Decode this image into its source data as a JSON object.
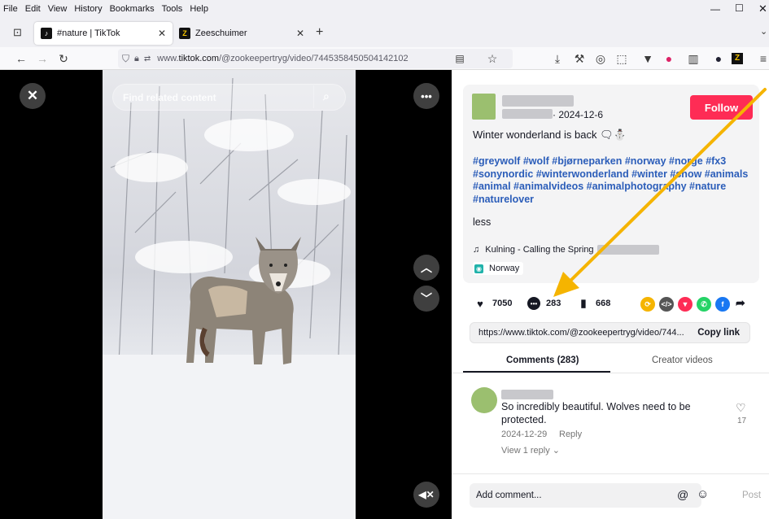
{
  "menu": [
    "File",
    "Edit",
    "View",
    "History",
    "Bookmarks",
    "Tools",
    "Help"
  ],
  "tabs": [
    {
      "title": "#nature | TikTok",
      "favicon": "tiktok-logo"
    },
    {
      "title": "Zeeschuimer",
      "favicon": "zeeschuimer-logo"
    }
  ],
  "url": {
    "prefix": "www.",
    "host": "tiktok.com",
    "path": "/@zookeepertryg/video/7445358450504142102"
  },
  "video": {
    "search_placeholder": "Find related content"
  },
  "post": {
    "date": "· 2024-12-6",
    "follow_label": "Follow",
    "caption": "Winter wonderland is back 🗨⛄",
    "hashtags": "#greywolf #wolf #bjørneparken #norway #norge #fx3 #sonynordic #winterwonderland #winter #snow #animals #animal #animalvideos #animalphotography #nature #naturelover",
    "less_label": "less",
    "music": "Kulning - Calling the Spring",
    "location": "Norway"
  },
  "stats": {
    "likes": "7050",
    "comments": "283",
    "saves": "668"
  },
  "link": {
    "url": "https://www.tiktok.com/@zookeepertryg/video/744...",
    "copy_label": "Copy link"
  },
  "content_tabs": {
    "comments": "Comments (283)",
    "creator": "Creator videos"
  },
  "comment": {
    "text": "So incredibly beautiful. Wolves need to be protected.",
    "date": "2024-12-29",
    "reply_label": "Reply",
    "view_replies": "View 1 reply ⌄",
    "likes": "17"
  },
  "comment_input": {
    "placeholder": "Add comment...",
    "post_label": "Post"
  },
  "colors": {
    "accent": "#fe2c55",
    "hashtag": "#2b5db9",
    "arrow": "#f5b400"
  }
}
